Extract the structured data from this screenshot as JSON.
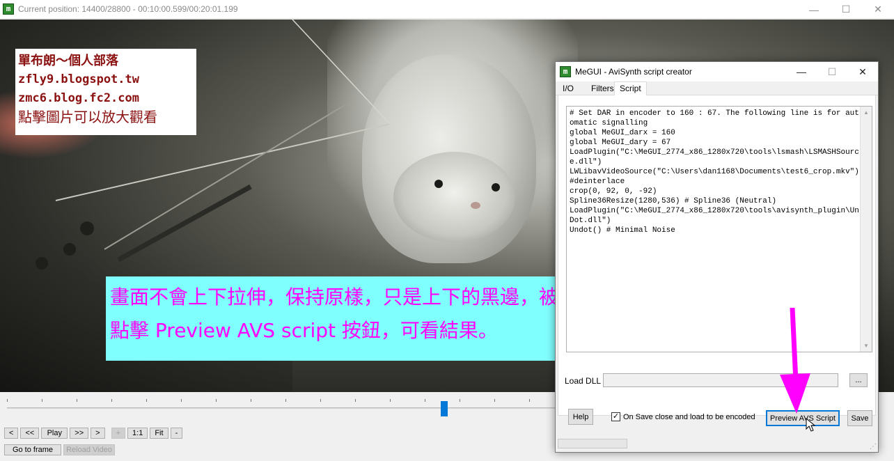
{
  "main_window": {
    "title": "Current position: 14400/28800   -   00:10:00.599/00:20:01.199",
    "icon_glyph": "m"
  },
  "blog_note": {
    "line1": "單布朗～個人部落",
    "line2": "zfly9.blogspot.tw",
    "line3": "zmc6.blog.fc2.com",
    "line4": "點擊圖片可以放大觀看"
  },
  "annotation": {
    "line1": "畫面不會上下拉伸，保持原樣，只是上下的黑邊，被切掉；",
    "line2": "點擊 Preview AVS script 按鈕，可看結果。"
  },
  "seek": {
    "position_fraction": 0.5
  },
  "controls": {
    "row1": [
      "<",
      "<<",
      "Play",
      ">>",
      ">",
      "+",
      "1:1",
      "Fit",
      "-"
    ],
    "go_to_frame": "Go to frame",
    "reload_video": "Reload Video"
  },
  "dialog": {
    "title": "MeGUI - AviSynth script creator",
    "tabs": [
      "I/O",
      "Filters",
      "Script"
    ],
    "active_tab": "Script",
    "script": "# Set DAR in encoder to 160 : 67. The following line is for automatic signalling\nglobal MeGUI_darx = 160\nglobal MeGUI_dary = 67\nLoadPlugin(\"C:\\MeGUI_2774_x86_1280x720\\tools\\lsmash\\LSMASHSource.dll\")\nLWLibavVideoSource(\"C:\\Users\\dan1168\\Documents\\test6_crop.mkv\")\n#deinterlace\ncrop(0, 92, 0, -92)\nSpline36Resize(1280,536) # Spline36 (Neutral)\nLoadPlugin(\"C:\\MeGUI_2774_x86_1280x720\\tools\\avisynth_plugin\\UnDot.dll\")\nUndot() # Minimal Noise",
    "load_dll_label": "Load DLL",
    "load_dll_value": "",
    "browse_label": "...",
    "help_label": "Help",
    "on_save_label": "On Save close and load to be encoded",
    "on_save_checked": true,
    "preview_label": "Preview AVS Script",
    "save_label": "Save"
  },
  "colors": {
    "annotation_bg": "#80ffff",
    "annotation_text": "#ff00ff",
    "blog_text": "#8b1010",
    "accent": "#0078d7"
  }
}
